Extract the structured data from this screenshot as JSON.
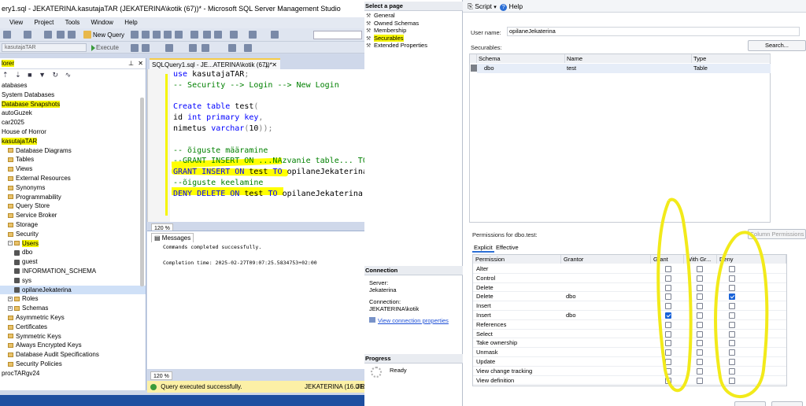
{
  "window": {
    "title": "ery1.sql - JEKATERINA.kasutajaTAR (JEKATERINA\\kotik (67))* - Microsoft SQL Server Management Studio"
  },
  "menu": [
    "View",
    "Project",
    "Tools",
    "Window",
    "Help"
  ],
  "toolbar": {
    "new_query": "New Query",
    "execute": "Execute",
    "db_select": "kasutajaTAR"
  },
  "explorer": {
    "header": "lorer",
    "items": [
      {
        "label": "atabases",
        "type": "folder",
        "indent": 0
      },
      {
        "label": "System Databases",
        "type": "folder",
        "indent": 0
      },
      {
        "label": "Database Snapshots",
        "type": "folder",
        "indent": 0,
        "highlight": true
      },
      {
        "label": "autoGuzek",
        "type": "db",
        "indent": 0
      },
      {
        "label": "car2025",
        "type": "db",
        "indent": 0
      },
      {
        "label": "House of Horror",
        "type": "db",
        "indent": 0
      },
      {
        "label": "kasutajaTAR",
        "type": "db",
        "indent": 0,
        "highlight": true
      },
      {
        "label": "Database Diagrams",
        "type": "folder",
        "indent": 1
      },
      {
        "label": "Tables",
        "type": "folder",
        "indent": 1
      },
      {
        "label": "Views",
        "type": "folder",
        "indent": 1
      },
      {
        "label": "External Resources",
        "type": "folder",
        "indent": 1
      },
      {
        "label": "Synonyms",
        "type": "folder",
        "indent": 1
      },
      {
        "label": "Programmability",
        "type": "folder",
        "indent": 1
      },
      {
        "label": "Query Store",
        "type": "folder",
        "indent": 1
      },
      {
        "label": "Service Broker",
        "type": "folder",
        "indent": 1
      },
      {
        "label": "Storage",
        "type": "folder",
        "indent": 1
      },
      {
        "label": "Security",
        "type": "folder",
        "indent": 1
      },
      {
        "label": "Users",
        "type": "folder",
        "indent": 1,
        "highlight": true
      },
      {
        "label": "dbo",
        "type": "user",
        "indent": 2
      },
      {
        "label": "guest",
        "type": "user",
        "indent": 2
      },
      {
        "label": "INFORMATION_SCHEMA",
        "type": "user",
        "indent": 2
      },
      {
        "label": "sys",
        "type": "user",
        "indent": 2
      },
      {
        "label": "opilaneJekaterina",
        "type": "user",
        "indent": 2,
        "selected": true
      },
      {
        "label": "Roles",
        "type": "folder",
        "indent": 1
      },
      {
        "label": "Schemas",
        "type": "folder",
        "indent": 1
      },
      {
        "label": "Asymmetric Keys",
        "type": "folder",
        "indent": 1
      },
      {
        "label": "Certificates",
        "type": "folder",
        "indent": 1
      },
      {
        "label": "Symmetric Keys",
        "type": "folder",
        "indent": 1
      },
      {
        "label": "Always Encrypted Keys",
        "type": "folder",
        "indent": 1
      },
      {
        "label": "Database Audit Specifications",
        "type": "folder",
        "indent": 1
      },
      {
        "label": "Security Policies",
        "type": "folder",
        "indent": 1
      },
      {
        "label": "procTARgv24",
        "type": "db",
        "indent": 0
      }
    ]
  },
  "editor": {
    "tab": "SQLQuery1.sql - JE...ATERINA\\kotik (67))*",
    "lines": [
      "use kasutajaTAR;",
      "-- Security --> Login --> New Login",
      "",
      "Create table test(",
      "id int primary key,",
      "nimetus varchar(10));",
      "",
      "-- õiguste määramine",
      "--GRANT INSERT ON ...NAzvanie table... TO",
      "GRANT INSERT ON test TO opilaneJekaterina;",
      "--õiguste keelamine",
      "DENY DELETE ON test TO opilaneJekaterina;"
    ],
    "zoom": "120 %"
  },
  "messages": {
    "tab": "Messages",
    "line1": "Commands completed successfully.",
    "line2": "Completion time: 2025-02-27T09:07:25.5834753+02:00",
    "zoom": "120 %"
  },
  "status": {
    "text": "Query executed successfully.",
    "server": "JEKATERINA (16.0 RTM)",
    "user": "JE"
  },
  "dialog": {
    "select_page": "Select a page",
    "pages": [
      "General",
      "Owned Schemas",
      "Membership",
      "Securables",
      "Extended Properties"
    ],
    "connection_header": "Connection",
    "server_label": "Server:",
    "server_value": "Jekaterina",
    "connection_label": "Connection:",
    "connection_value": "JEKATERINA\\kotik",
    "view_link": "View connection properties",
    "progress_header": "Progress",
    "progress_status": "Ready",
    "script": "Script",
    "help": "Help",
    "user_name_label": "User name:",
    "user_name_value": "opilaneJekaterina",
    "securables_label": "Securables:",
    "search_button": "Search...",
    "securable_columns": [
      "Schema",
      "Name",
      "Type"
    ],
    "securable_row": {
      "schema": "dbo",
      "name": "test",
      "type": "Table"
    },
    "permissions_for": "Permissions for dbo.test:",
    "column_permissions": "Column Permissions",
    "tabs": [
      "Explicit",
      "Effective"
    ],
    "perm_columns": [
      "Permission",
      "Grantor",
      "Grant",
      "With Gr...",
      "Deny"
    ],
    "permissions": [
      {
        "name": "Alter",
        "grantor": "",
        "grant": false,
        "with": false,
        "deny": false
      },
      {
        "name": "Control",
        "grantor": "",
        "grant": false,
        "with": false,
        "deny": false
      },
      {
        "name": "Delete",
        "grantor": "",
        "grant": false,
        "with": false,
        "deny": false
      },
      {
        "name": "Delete",
        "grantor": "dbo",
        "grant": false,
        "with": false,
        "deny": true
      },
      {
        "name": "Insert",
        "grantor": "",
        "grant": false,
        "with": false,
        "deny": false
      },
      {
        "name": "Insert",
        "grantor": "dbo",
        "grant": true,
        "with": false,
        "deny": false
      },
      {
        "name": "References",
        "grantor": "",
        "grant": false,
        "with": false,
        "deny": false
      },
      {
        "name": "Select",
        "grantor": "",
        "grant": false,
        "with": false,
        "deny": false
      },
      {
        "name": "Take ownership",
        "grantor": "",
        "grant": false,
        "with": false,
        "deny": false
      },
      {
        "name": "Unmask",
        "grantor": "",
        "grant": false,
        "with": false,
        "deny": false
      },
      {
        "name": "Update",
        "grantor": "",
        "grant": false,
        "with": false,
        "deny": false
      },
      {
        "name": "View change tracking",
        "grantor": "",
        "grant": false,
        "with": false,
        "deny": false
      },
      {
        "name": "View definition",
        "grantor": "",
        "grant": false,
        "with": false,
        "deny": false
      }
    ]
  },
  "colors": {
    "highlight": "#f5f500",
    "accent": "#1a63d8",
    "status_bar": "#fcf0a6"
  }
}
